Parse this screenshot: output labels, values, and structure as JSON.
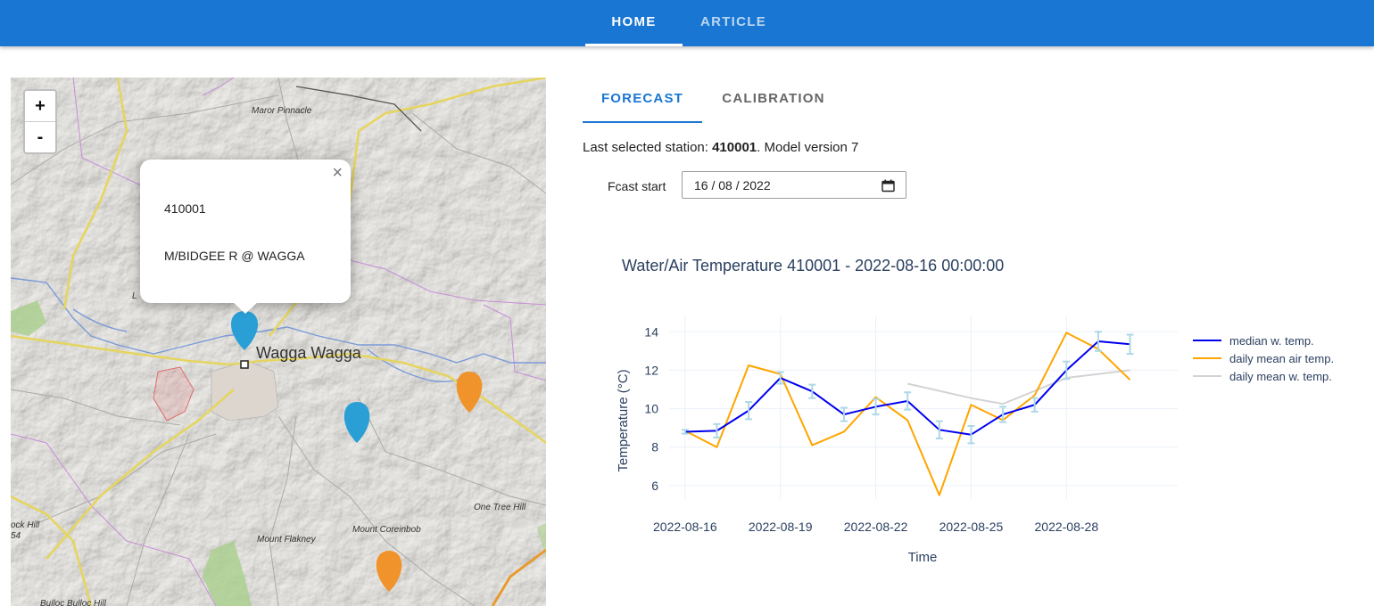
{
  "nav": {
    "tabs": [
      {
        "label": "HOME",
        "active": true
      },
      {
        "label": "ARTICLE",
        "active": false
      }
    ]
  },
  "map": {
    "zoom_in": "+",
    "zoom_out": "-",
    "place_labels": [
      "Maror Pinnacle",
      "Wagga Wagga",
      "One Tree Hill",
      "Mount Coreinbob",
      "Mount Flakney",
      "Bulloc Bulloc Hill",
      "ock Hill",
      "54",
      "L"
    ],
    "popup": {
      "station_id": "410001",
      "station_name": "M/BIDGEE R @ WAGGA",
      "close": "×"
    },
    "marker_colors": {
      "selected": "#2a9fd6",
      "other": "#f0932b"
    }
  },
  "subtabs": [
    {
      "label": "FORECAST",
      "active": true
    },
    {
      "label": "CALIBRATION",
      "active": false
    }
  ],
  "info": {
    "prefix": "Last selected station: ",
    "station": "410001",
    "suffix": ". Model version 7"
  },
  "forecast": {
    "label": "Fcast start",
    "date_value": "16 / 08 / 2022",
    "icon": "calendar-icon"
  },
  "chart_data": {
    "type": "line",
    "title": "Water/Air Temperature 410001 - 2022-08-16 00:00:00",
    "xlabel": "Time",
    "ylabel": "Temperature (°C)",
    "xlim": [
      "2022-08-15T12:00",
      "2022-08-31T12:00"
    ],
    "ylim": [
      5.3,
      14.8
    ],
    "xticks": [
      "2022-08-16",
      "2022-08-19",
      "2022-08-22",
      "2022-08-25",
      "2022-08-28"
    ],
    "yticks": [
      6,
      8,
      10,
      12,
      14
    ],
    "grid": true,
    "legend_position": "top-right",
    "series": [
      {
        "name": "median w. temp.",
        "color": "#0000ee",
        "x": [
          "2022-08-16",
          "2022-08-17",
          "2022-08-18",
          "2022-08-19",
          "2022-08-20",
          "2022-08-21",
          "2022-08-22",
          "2022-08-23",
          "2022-08-24",
          "2022-08-25",
          "2022-08-26",
          "2022-08-27",
          "2022-08-28",
          "2022-08-29",
          "2022-08-30"
        ],
        "y": [
          8.8,
          8.85,
          9.9,
          11.6,
          10.9,
          9.7,
          10.1,
          10.4,
          8.9,
          8.65,
          9.7,
          10.2,
          12.0,
          13.5,
          13.35
        ],
        "error": [
          0.1,
          0.35,
          0.45,
          0.3,
          0.35,
          0.35,
          0.4,
          0.45,
          0.45,
          0.45,
          0.4,
          0.35,
          0.45,
          0.5,
          0.5
        ],
        "error_color": "#add8e6"
      },
      {
        "name": "daily mean air temp.",
        "color": "#ffa500",
        "x": [
          "2022-08-16",
          "2022-08-17",
          "2022-08-18",
          "2022-08-19",
          "2022-08-20",
          "2022-08-21",
          "2022-08-22",
          "2022-08-23",
          "2022-08-24",
          "2022-08-25",
          "2022-08-26",
          "2022-08-27",
          "2022-08-28",
          "2022-08-29",
          "2022-08-30"
        ],
        "y": [
          8.85,
          8.0,
          12.25,
          11.8,
          8.1,
          8.8,
          10.6,
          9.4,
          5.5,
          10.2,
          9.4,
          10.7,
          13.95,
          13.1,
          11.5
        ]
      },
      {
        "name": "daily mean w. temp.",
        "color": "#d3d3d3",
        "x": [
          "2022-08-23",
          "2022-08-25",
          "2022-08-26",
          "2022-08-28",
          "2022-08-30"
        ],
        "y": [
          11.3,
          10.55,
          10.25,
          11.6,
          12.0
        ]
      }
    ]
  }
}
